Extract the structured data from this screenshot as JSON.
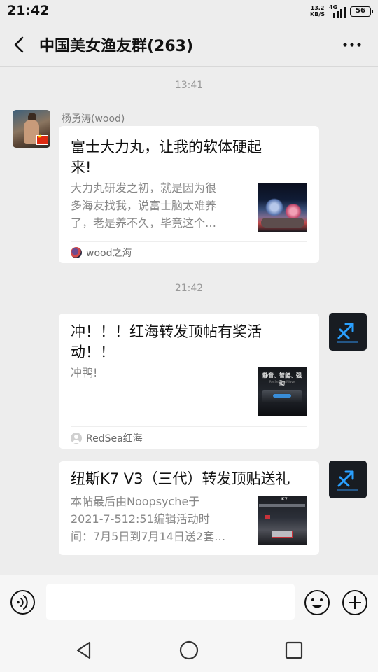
{
  "status_bar": {
    "time": "21:42",
    "net_speed_value": "13.2",
    "net_speed_unit": "KB/S",
    "network_type": "4G",
    "battery": "56"
  },
  "header": {
    "title": "中国美女渔友群(263)",
    "back_icon": "chevron-left-icon",
    "more_icon": "ellipsis-icon"
  },
  "messages": [
    {
      "timestamp": "13:41",
      "sender_name": "杨勇涛(wood)",
      "side": "left",
      "title": "富士大力丸，让我的软体硬起来!",
      "title_lines": [
        "富士大力丸，让我的软体硬起",
        "来!"
      ],
      "desc_lines": [
        "大力丸研发之初，就是因为很",
        "多海友找我，说富士脑太难养",
        "了，老是养不久，毕竟这个…"
      ],
      "source": "wood之海"
    },
    {
      "timestamp": "21:42",
      "side": "right",
      "title_lines": [
        "冲！！！红海转发顶帖有奖活",
        "动！！"
      ],
      "desc_lines": [
        "冲鸭!"
      ],
      "thumb_text": "静音、智能、强劲",
      "thumb_subtext": "RedSea ReefWave",
      "source": "RedSea红海"
    },
    {
      "side": "right",
      "title_lines": [
        "纽斯K7 V3（三代）转发顶贴送礼"
      ],
      "desc_lines": [
        "本帖最后由Noopsyche于",
        "2021-7-512:51编辑活动时",
        "间：7月5日到7月14日送2套…"
      ]
    }
  ],
  "input_bar": {
    "placeholder": "",
    "value": ""
  },
  "colors": {
    "background": "#ededed",
    "card": "#ffffff",
    "timestamp_text": "#999999",
    "source_text": "#6b6b6b"
  }
}
